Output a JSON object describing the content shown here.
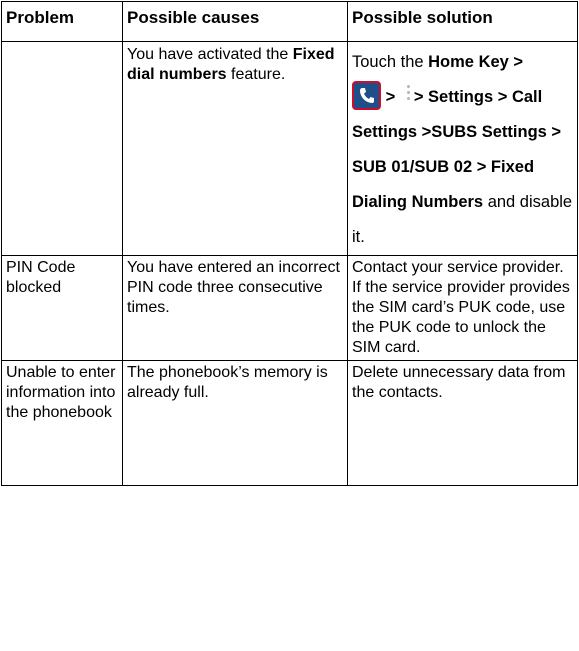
{
  "headers": [
    "Problem",
    "Possible causes",
    "Possible solution"
  ],
  "row1": {
    "problem": "",
    "cause": {
      "pre": "You have activated the ",
      "bold": "Fixed dial numbers",
      "post": " feature."
    },
    "solution": {
      "touch_the": "Touch the ",
      "home_key": "Home Key >",
      "sep1": " > ",
      "settings": "> Settings >",
      "call_settings": "Call Settings >SUBS Settings > SUB 01/SUB 02 > Fixed Dialing Numbers",
      "and": " and disable it.",
      "phone_icon": "phone-icon",
      "menu_icon": "more-options-icon"
    }
  },
  "row2": {
    "problem": "PIN Code blocked",
    "cause": "You have entered an incorrect PIN code three consecutive times.",
    "solution": "Contact your service provider. If the service provider provides the SIM card’s PUK code, use the PUK code to unlock the SIM card."
  },
  "row3": {
    "problem": "Unable to enter information into the phonebook",
    "cause": "The phonebook’s memory is already full.",
    "solution": "Delete unnecessary data from the contacts."
  }
}
